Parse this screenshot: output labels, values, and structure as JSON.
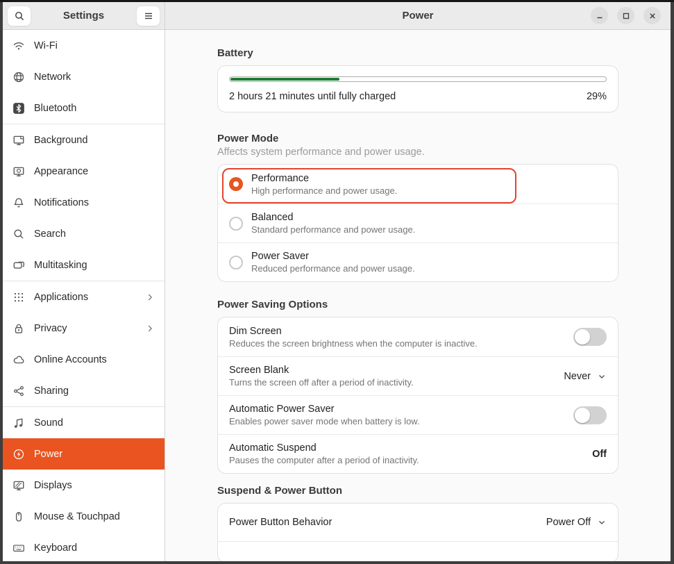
{
  "header": {
    "sidebar_title": "Settings",
    "content_title": "Power"
  },
  "sidebar": {
    "items": [
      {
        "label": "Wi-Fi",
        "icon": "wifi-icon"
      },
      {
        "label": "Network",
        "icon": "network-icon"
      },
      {
        "label": "Bluetooth",
        "icon": "bluetooth-icon"
      },
      {
        "label": "Background",
        "icon": "background-icon"
      },
      {
        "label": "Appearance",
        "icon": "appearance-icon"
      },
      {
        "label": "Notifications",
        "icon": "notifications-icon"
      },
      {
        "label": "Search",
        "icon": "search-icon"
      },
      {
        "label": "Multitasking",
        "icon": "multitasking-icon"
      },
      {
        "label": "Applications",
        "icon": "applications-icon",
        "chevron": true
      },
      {
        "label": "Privacy",
        "icon": "privacy-icon",
        "chevron": true
      },
      {
        "label": "Online Accounts",
        "icon": "online-accounts-icon"
      },
      {
        "label": "Sharing",
        "icon": "sharing-icon"
      },
      {
        "label": "Sound",
        "icon": "sound-icon"
      },
      {
        "label": "Power",
        "icon": "power-icon",
        "active": true
      },
      {
        "label": "Displays",
        "icon": "displays-icon"
      },
      {
        "label": "Mouse & Touchpad",
        "icon": "mouse-icon"
      },
      {
        "label": "Keyboard",
        "icon": "keyboard-icon"
      }
    ]
  },
  "battery": {
    "section_title": "Battery",
    "status_text": "2 hours 21 minutes until fully charged",
    "percent_label": "29%",
    "percent_value": 29,
    "bar_color": "#1e7b32"
  },
  "power_mode": {
    "section_title": "Power Mode",
    "section_subtitle": "Affects system performance and power usage.",
    "options": [
      {
        "title": "Performance",
        "subtitle": "High performance and power usage.",
        "selected": true,
        "highlighted": true
      },
      {
        "title": "Balanced",
        "subtitle": "Standard performance and power usage.",
        "selected": false
      },
      {
        "title": "Power Saver",
        "subtitle": "Reduced performance and power usage.",
        "selected": false
      }
    ]
  },
  "power_saving": {
    "section_title": "Power Saving Options",
    "rows": [
      {
        "title": "Dim Screen",
        "subtitle": "Reduces the screen brightness when the computer is inactive.",
        "control": "toggle",
        "state": "off"
      },
      {
        "title": "Screen Blank",
        "subtitle": "Turns the screen off after a period of inactivity.",
        "control": "dropdown",
        "value": "Never"
      },
      {
        "title": "Automatic Power Saver",
        "subtitle": "Enables power saver mode when battery is low.",
        "control": "toggle",
        "state": "off"
      },
      {
        "title": "Automatic Suspend",
        "subtitle": "Pauses the computer after a period of inactivity.",
        "control": "value",
        "value": "Off"
      }
    ]
  },
  "suspend_section": {
    "section_title": "Suspend & Power Button",
    "rows": [
      {
        "title": "Power Button Behavior",
        "control": "dropdown",
        "value": "Power Off"
      }
    ]
  },
  "window_controls": {
    "minimize": "minimize",
    "maximize": "maximize",
    "close": "close"
  },
  "colors": {
    "accent": "#E95420",
    "highlight_outline": "#E0432C",
    "battery_green": "#1e7b32"
  }
}
